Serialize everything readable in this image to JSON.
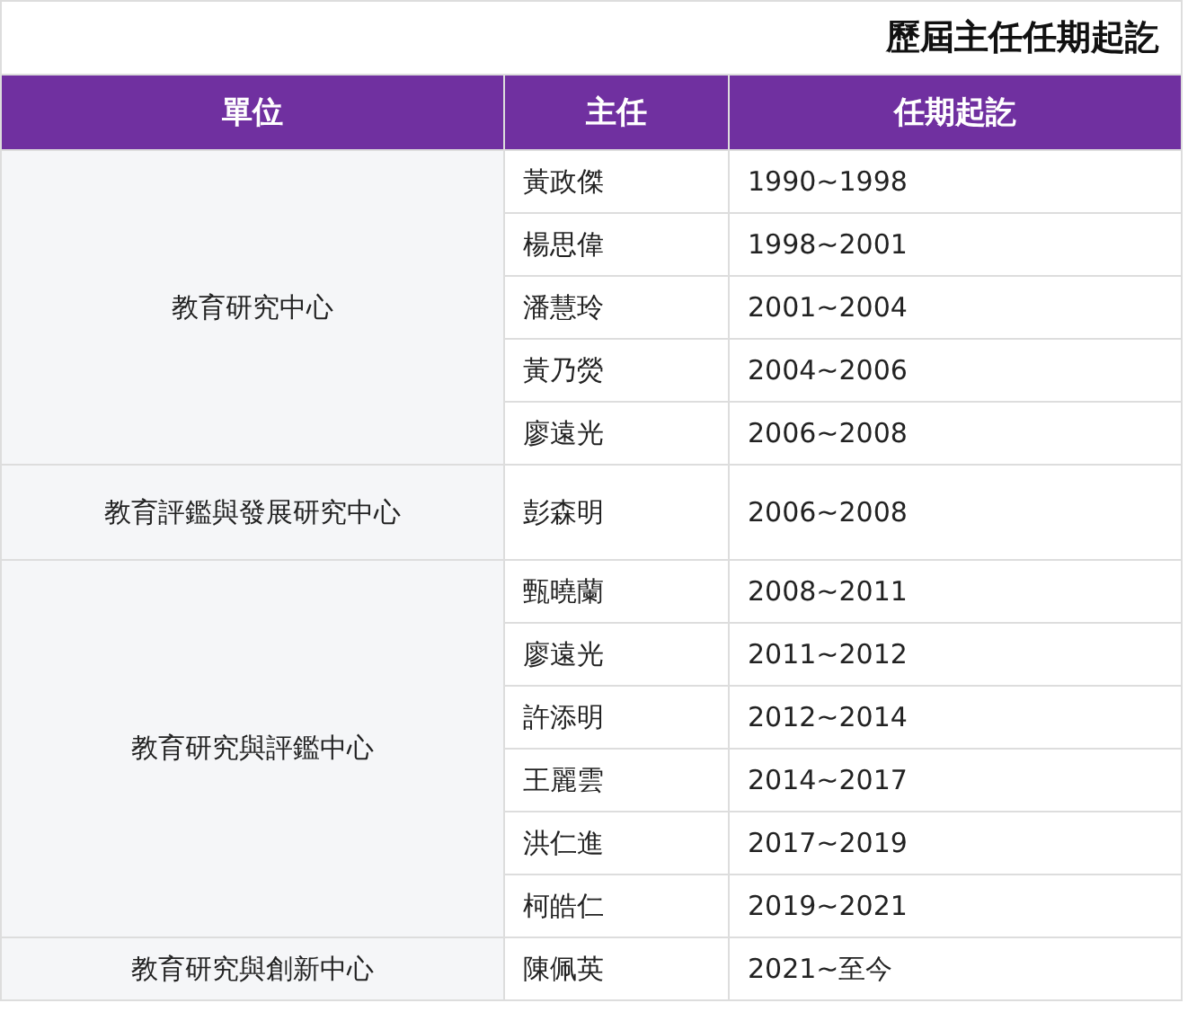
{
  "title": "歷屆主任任期起訖",
  "columns": [
    "單位",
    "主任",
    "任期起訖"
  ],
  "groups": [
    {
      "unit": "教育研究中心",
      "members": [
        {
          "name": "黃政傑",
          "term": "1990~1998"
        },
        {
          "name": "楊思偉",
          "term": "1998~2001"
        },
        {
          "name": "潘慧玲",
          "term": "2001~2004"
        },
        {
          "name": "黃乃熒",
          "term": "2004~2006"
        },
        {
          "name": "廖遠光",
          "term": "2006~2008"
        }
      ]
    },
    {
      "unit": "教育評鑑與發展研究中心",
      "members": [
        {
          "name": "彭森明",
          "term": "2006~2008"
        }
      ]
    },
    {
      "unit": "教育研究與評鑑中心",
      "members": [
        {
          "name": "甄曉蘭",
          "term": "2008~2011"
        },
        {
          "name": "廖遠光",
          "term": "2011~2012"
        },
        {
          "name": "許添明",
          "term": "2012~2014"
        },
        {
          "name": "王麗雲",
          "term": "2014~2017"
        },
        {
          "name": "洪仁進",
          "term": "2017~2019"
        },
        {
          "name": "柯皓仁",
          "term": "2019~2021"
        }
      ]
    },
    {
      "unit": "教育研究與創新中心",
      "members": [
        {
          "name": "陳佩英",
          "term": "2021~至今"
        }
      ]
    }
  ]
}
